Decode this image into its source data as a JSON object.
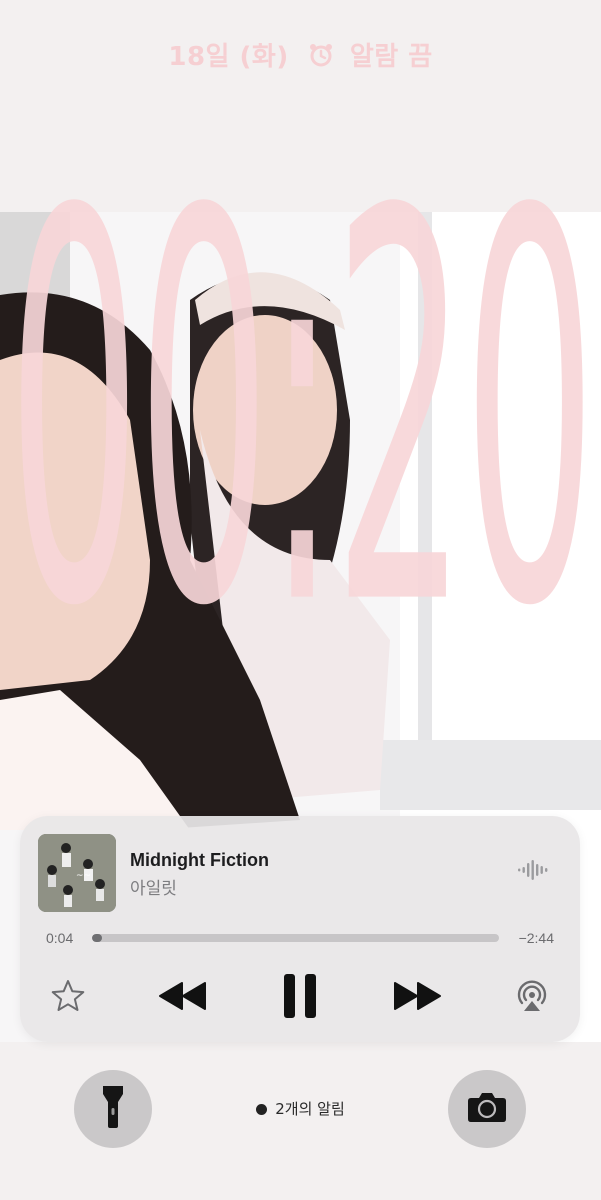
{
  "lockscreen": {
    "date": "18일 (화)",
    "alarm_label": "알람 끔",
    "time": "00:20",
    "clock_color": "#f7d6d8"
  },
  "now_playing": {
    "title": "Midnight Fiction",
    "artist": "아일릿",
    "elapsed": "0:04",
    "remaining": "−2:44",
    "progress": 0.024,
    "controls": [
      "star-icon",
      "rewind-icon",
      "pause-icon",
      "fast-forward-icon",
      "airplay-icon"
    ]
  },
  "bottom": {
    "left_icon": "flashlight-icon",
    "right_icon": "camera-icon",
    "notifications": "2개의 알림"
  }
}
